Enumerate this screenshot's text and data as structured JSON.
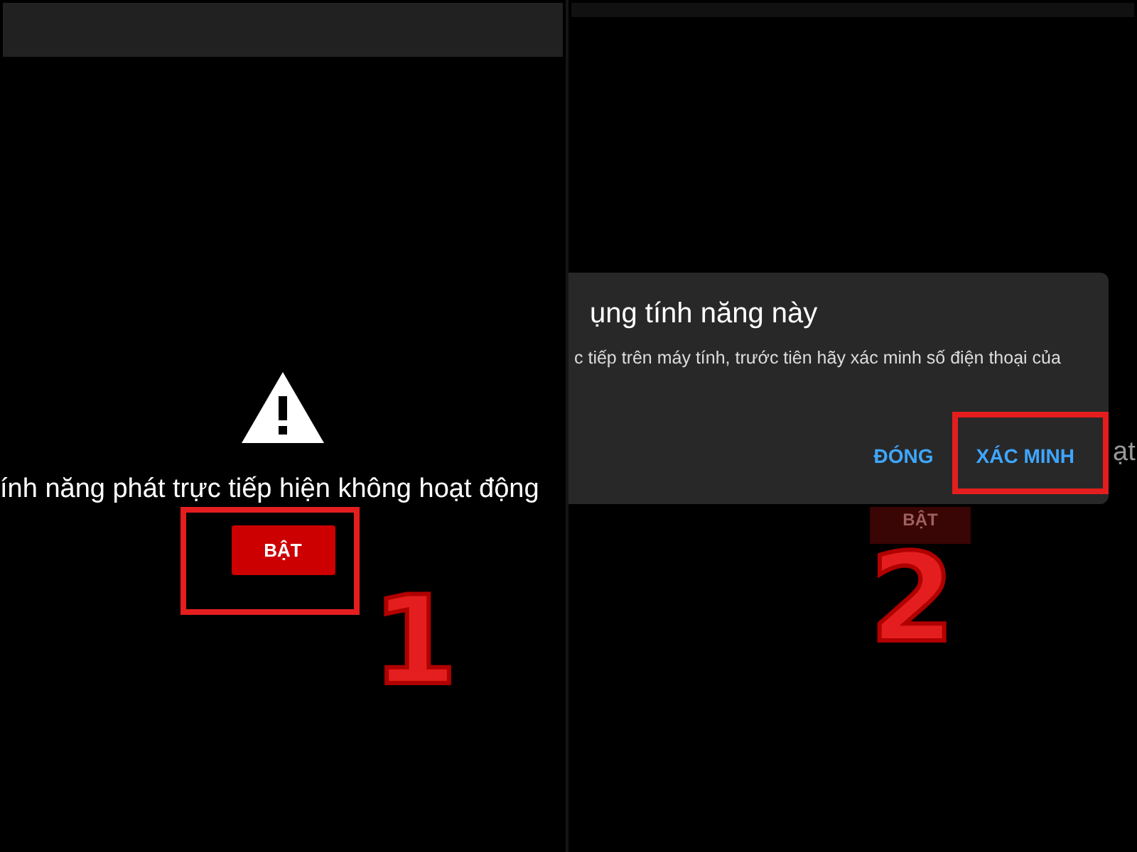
{
  "left_screen": {
    "warning_message": "ính năng phát trực tiếp hiện không hoạt động",
    "enable_button": "BẬT"
  },
  "right_screen": {
    "background_text": "ạt",
    "background_button": "BẬT",
    "dialog": {
      "title": "ụng tính năng này",
      "body": "c tiếp trên máy tính, trước tiên hãy xác minh số điện thoại của",
      "buttons": [
        {
          "label": "ĐÓNG"
        },
        {
          "label": "XÁC MINH"
        }
      ]
    }
  },
  "annotations": [
    {
      "number": "1"
    },
    {
      "number": "2"
    }
  ]
}
